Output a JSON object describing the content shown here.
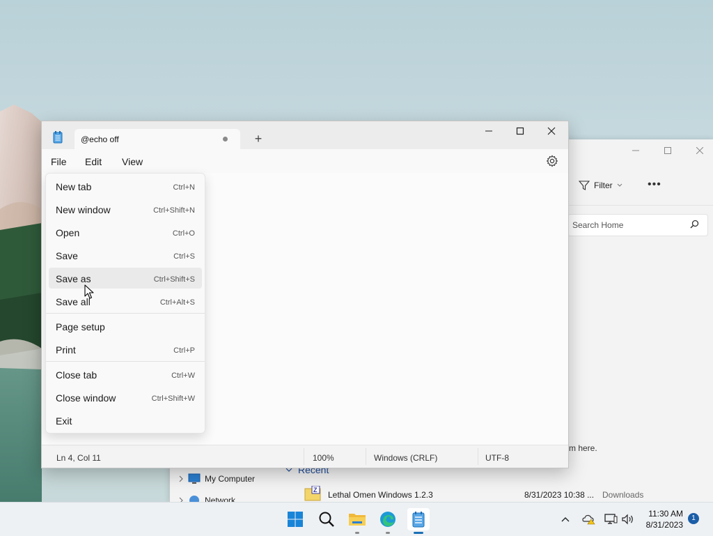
{
  "notepad": {
    "tab_title": "@echo off",
    "new_tab_symbol": "+",
    "menus": [
      "File",
      "Edit",
      "View"
    ],
    "icons": {
      "app": "notepad-icon",
      "minimize": "minimize-icon",
      "maximize": "maximize-icon",
      "close": "close-icon",
      "settings": "gear-icon"
    },
    "status": {
      "position": "Ln 4, Col 11",
      "zoom": "100%",
      "line_ending": "Windows (CRLF)",
      "encoding": "UTF-8"
    }
  },
  "file_menu": {
    "items": [
      {
        "label": "New tab",
        "shortcut": "Ctrl+N"
      },
      {
        "label": "New window",
        "shortcut": "Ctrl+Shift+N"
      },
      {
        "label": "Open",
        "shortcut": "Ctrl+O"
      },
      {
        "label": "Save",
        "shortcut": "Ctrl+S"
      },
      {
        "label": "Save as",
        "shortcut": "Ctrl+Shift+S",
        "hovered": true
      },
      {
        "label": "Save all",
        "shortcut": "Ctrl+Alt+S"
      },
      {
        "label": "Page setup",
        "shortcut": ""
      },
      {
        "label": "Print",
        "shortcut": "Ctrl+P"
      },
      {
        "label": "Close tab",
        "shortcut": "Ctrl+W"
      },
      {
        "label": "Close window",
        "shortcut": "Ctrl+Shift+W"
      },
      {
        "label": "Exit",
        "shortcut": ""
      }
    ]
  },
  "explorer": {
    "filter_label": "Filter",
    "more_label": "•••",
    "search_placeholder": "Search Home",
    "hint_text": "m here.",
    "nav": [
      {
        "label": "My Computer"
      },
      {
        "label": "Network"
      }
    ],
    "recent_label": "Recent",
    "recent_file": {
      "name": "Lethal Omen Windows 1.2.3",
      "date": "8/31/2023 10:38 ...",
      "location": "Downloads"
    }
  },
  "taskbar": {
    "apps": [
      "windows-start-icon",
      "search-icon",
      "file-explorer-icon",
      "edge-browser-icon",
      "notepad-icon"
    ],
    "tray_icons": [
      "chevron-up-icon",
      "onedrive-warning-icon",
      "network-icon",
      "volume-icon"
    ],
    "time": "11:30 AM",
    "date": "8/31/2023",
    "notification_count": "1"
  },
  "colors": {
    "accent": "#1b6fb6",
    "hover": "#eaeaea",
    "titlebar": "#ececec"
  }
}
